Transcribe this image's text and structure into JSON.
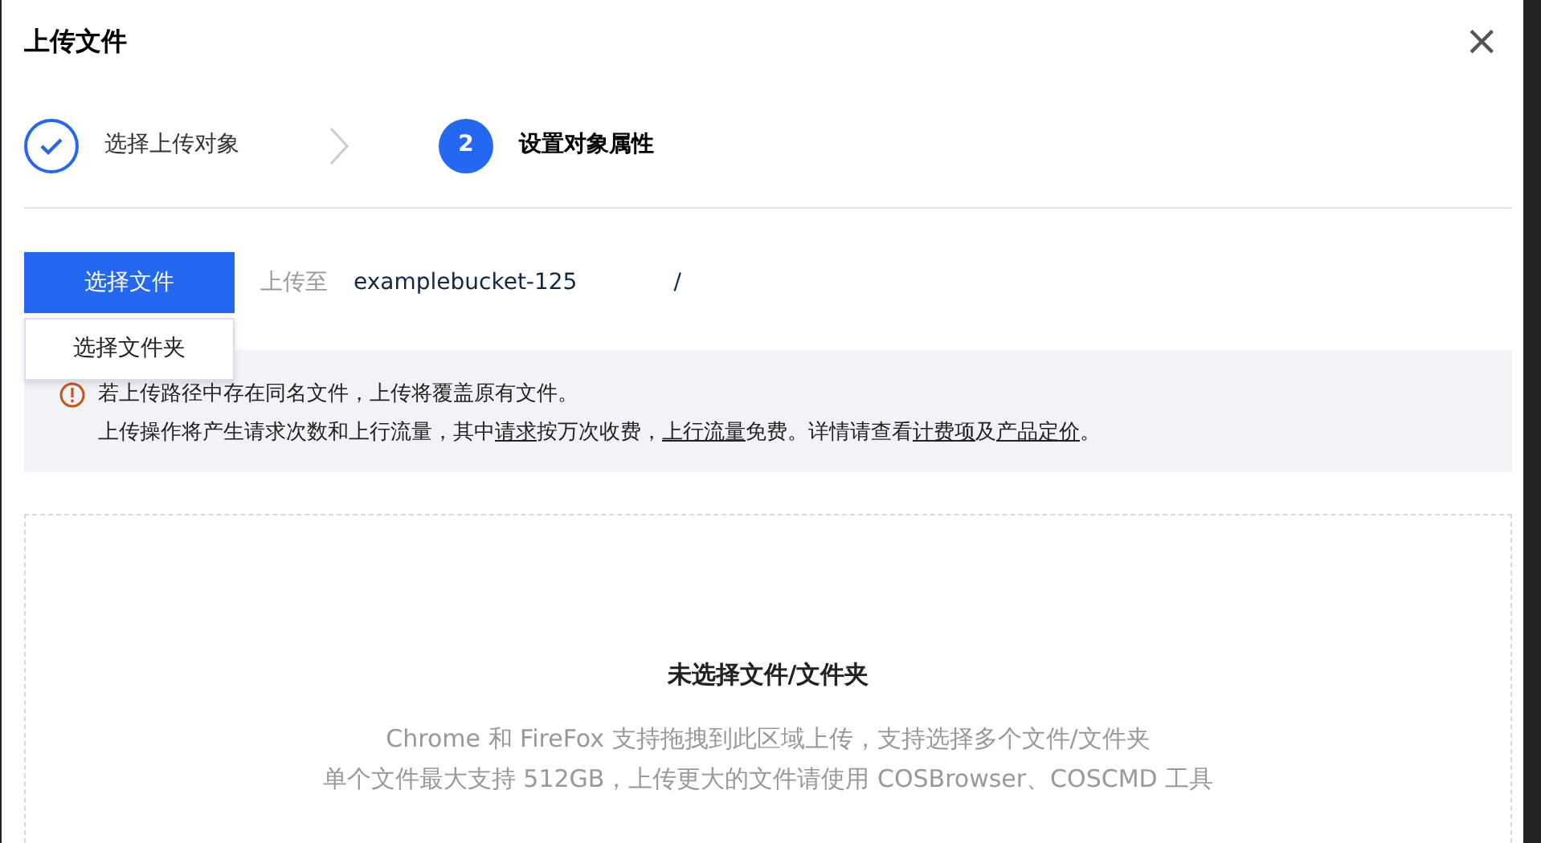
{
  "dialog": {
    "title": "上传文件",
    "close": "×"
  },
  "steps": [
    {
      "kind": "done",
      "label": "选择上传对象",
      "selected": false
    },
    {
      "kind": "number",
      "number": "2",
      "label": "设置对象属性",
      "selected": true
    }
  ],
  "upload": {
    "button": "选择文件",
    "menu": [
      {
        "label": "选择文件夹"
      }
    ],
    "target_label": "上传至",
    "bucket": "examplebucket-125",
    "path_suffix": "/"
  },
  "notice": {
    "lines": [
      [
        {
          "kind": "text",
          "text": "若上传路径中存在同名文件，上传将覆盖原有文件。"
        }
      ],
      [
        {
          "kind": "text",
          "text": "上传操作将产生请求次数和上行流量，其中"
        },
        {
          "kind": "link",
          "text": "请求"
        },
        {
          "kind": "text",
          "text": "按万次收费，"
        },
        {
          "kind": "link",
          "text": "上行流量"
        },
        {
          "kind": "text",
          "text": "免费。详情请查看"
        },
        {
          "kind": "link",
          "text": "计费项"
        },
        {
          "kind": "text",
          "text": "及"
        },
        {
          "kind": "link",
          "text": "产品定价"
        },
        {
          "kind": "text",
          "text": "。"
        }
      ]
    ]
  },
  "dropzone": {
    "title": "未选择文件/文件夹",
    "hints": [
      "Chrome 和 FireFox 支持拖拽到此区域上传，支持选择多个文件/文件夹",
      "单个文件最大支持 512GB，上传更大的文件请使用 COSBrowser、COSCMD 工具"
    ]
  }
}
